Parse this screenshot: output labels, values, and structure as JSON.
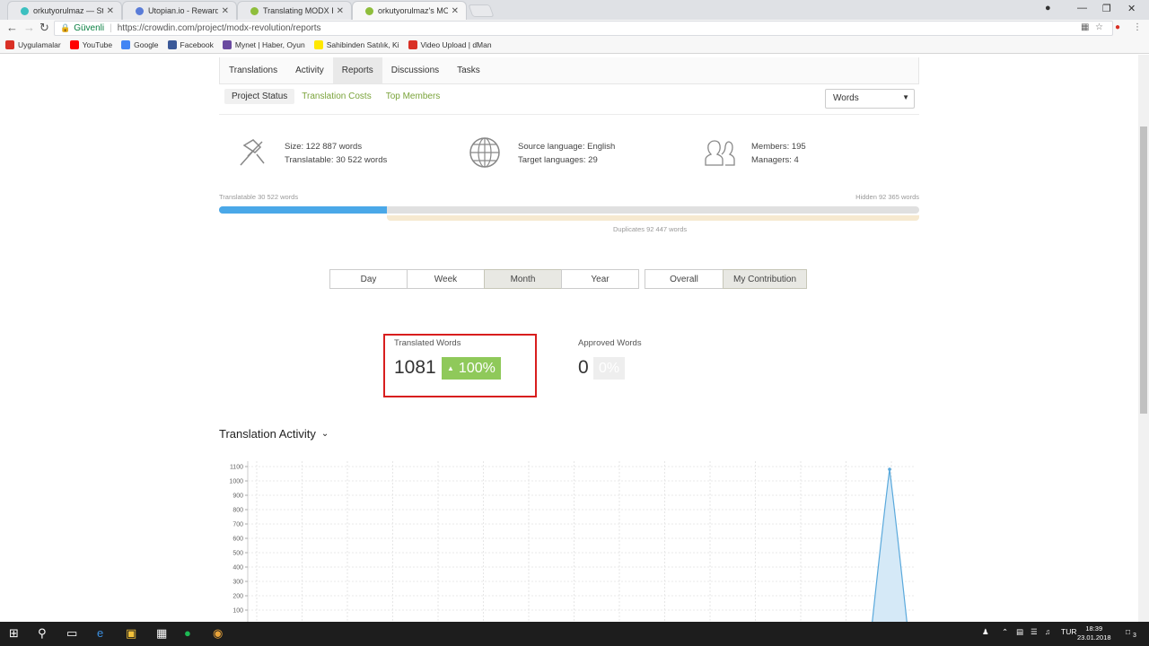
{
  "browser": {
    "tabs": [
      {
        "title": "orkutyorulmaz — Steem",
        "color": "#3cc0c0"
      },
      {
        "title": "Utopian.io - Rewarding O",
        "color": "#5a7cd8"
      },
      {
        "title": "Translating MODX Revolu",
        "color": "#8fbe3c"
      },
      {
        "title": "orkutyorulmaz's MODX R",
        "color": "#8fbe3c"
      }
    ],
    "secure_label": "Güvenli",
    "url": "https://crowdin.com/project/modx-revolution/reports",
    "bookmarks": [
      {
        "label": "Uygulamalar",
        "color": "#d93025"
      },
      {
        "label": "YouTube",
        "color": "#ff0000"
      },
      {
        "label": "Google",
        "color": "#4285f4"
      },
      {
        "label": "Facebook",
        "color": "#3b5998"
      },
      {
        "label": "Mynet | Haber, Oyun",
        "color": "#6a4aa0"
      },
      {
        "label": "Sahibinden Satılık, Ki",
        "color": "#ffe800"
      },
      {
        "label": "Video Upload | dMan",
        "color": "#d93025"
      }
    ]
  },
  "nav": {
    "tabs": [
      "Translations",
      "Activity",
      "Reports",
      "Discussions",
      "Tasks"
    ],
    "active": "Reports"
  },
  "subnav": {
    "items": [
      "Project Status",
      "Translation Costs",
      "Top Members"
    ],
    "unit_select": "Words"
  },
  "stats": {
    "size": "Size: 122 887 words",
    "translatable": "Translatable: 30 522 words",
    "source_language": "Source language: English",
    "target_languages": "Target languages: 29",
    "members": "Members: 195",
    "managers": "Managers: 4"
  },
  "progress": {
    "translatable_label": "Translatable 30 522 words",
    "hidden_label": "Hidden 92 365 words",
    "duplicates_label": "Duplicates 92 447 words",
    "translatable_fraction": 0.24
  },
  "periods": {
    "group1": [
      "Day",
      "Week",
      "Month",
      "Year"
    ],
    "group1_active": "Month",
    "group2": [
      "Overall",
      "My Contribution"
    ],
    "group2_active": "My Contribution"
  },
  "metrics": {
    "translated_label": "Translated Words",
    "translated_value": "1081",
    "translated_change": "100%",
    "translated_arrow": "▲",
    "approved_label": "Approved Words",
    "approved_value": "0",
    "approved_change": "0%"
  },
  "activity": {
    "title": "Translation Activity"
  },
  "chart_data": {
    "type": "area",
    "ylim": [
      0,
      1100
    ],
    "yticks": [
      1100,
      1000,
      900,
      800,
      700,
      600,
      500,
      400,
      300,
      200,
      100
    ],
    "peak_value": 1081,
    "color": "#5aa9dc"
  },
  "taskbar": {
    "lang": "TUR",
    "time": "18:39",
    "date": "23.01.2018",
    "notif_count": "3"
  }
}
